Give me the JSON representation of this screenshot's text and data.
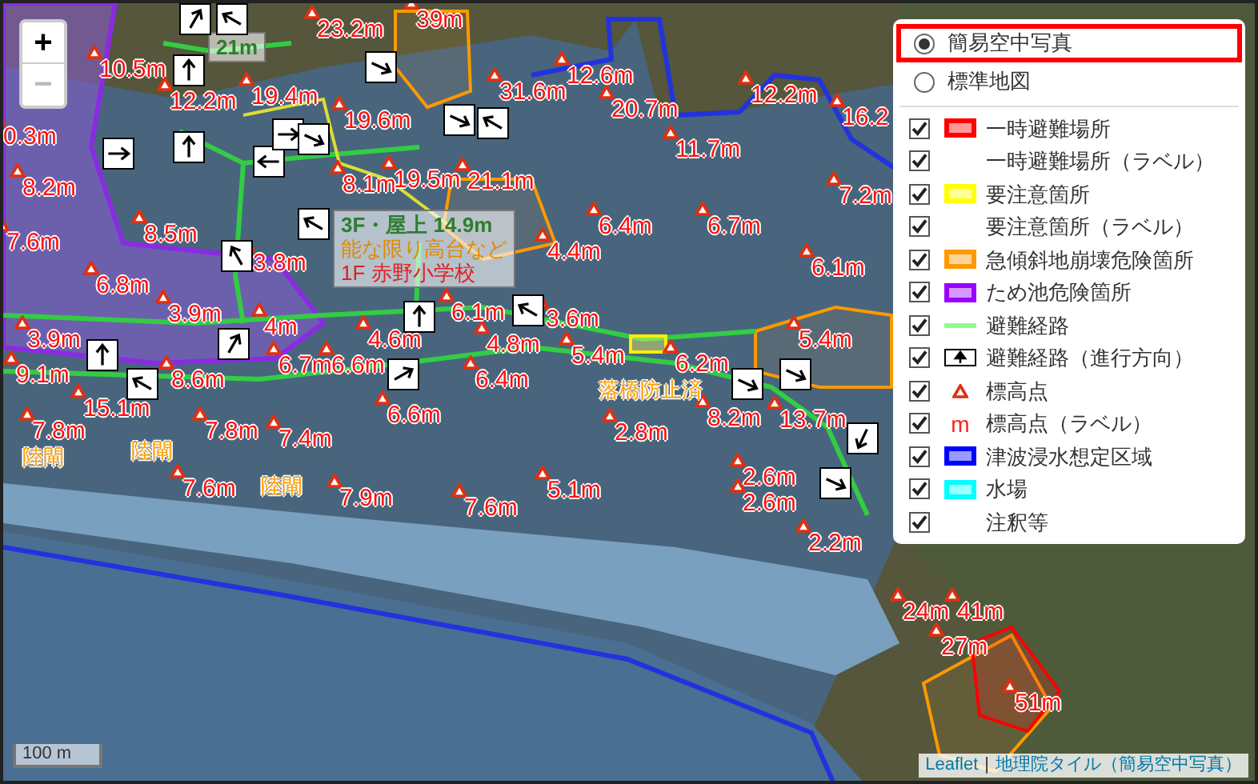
{
  "zoom_control": {
    "zoom_in": "+",
    "zoom_out": "−",
    "zoom_out_disabled": true
  },
  "layer_control": {
    "base_layers": [
      {
        "label": "簡易空中写真",
        "selected": true
      },
      {
        "label": "標準地図",
        "selected": false
      }
    ],
    "overlays": [
      {
        "label": "一時避難場所",
        "checked": true,
        "kind": "area",
        "color": "#ff0000"
      },
      {
        "label": "一時避難場所（ラベル）",
        "checked": true,
        "kind": "none"
      },
      {
        "label": "要注意箇所",
        "checked": true,
        "kind": "area",
        "color": "#ffff00"
      },
      {
        "label": "要注意箇所（ラベル）",
        "checked": true,
        "kind": "none"
      },
      {
        "label": "急傾斜地崩壊危険箇所",
        "checked": true,
        "kind": "area",
        "color": "#ff9900"
      },
      {
        "label": "ため池危険箇所",
        "checked": true,
        "kind": "area",
        "color": "#9900ff"
      },
      {
        "label": "避難経路",
        "checked": true,
        "kind": "line",
        "color": "#88ff88"
      },
      {
        "label": "避難経路（進行方向）",
        "checked": true,
        "kind": "arrow"
      },
      {
        "label": "標高点",
        "checked": true,
        "kind": "triangle"
      },
      {
        "label": "標高点（ラベル）",
        "checked": true,
        "kind": "symbol",
        "symbol": "m"
      },
      {
        "label": "津波浸水想定区域",
        "checked": true,
        "kind": "area",
        "color": "#0000ff"
      },
      {
        "label": "水場",
        "checked": true,
        "kind": "area",
        "color": "#00ffff"
      },
      {
        "label": "注釈等",
        "checked": true,
        "kind": "none"
      }
    ]
  },
  "elevation_labels": [
    "0.3m",
    "10.5m",
    "12.2m",
    "19.4m",
    "23.2m",
    "39m",
    "19.6m",
    "8.2m",
    "8.1m",
    "19.5m",
    "7.6m",
    "8.5m",
    "3.8m",
    "6.8m",
    "3.9m",
    "4m",
    "3.9m",
    "4.6m",
    "9.1m",
    "8.6m",
    "6.7m",
    "6.6m",
    "15.1m",
    "7.8m",
    "7.8m",
    "7.4m",
    "6.6m",
    "7.6m",
    "7.9m",
    "7.6m",
    "5.1m",
    "2.8m",
    "2.6m",
    "2.6m",
    "2.2m",
    "8.2m",
    "13.7m",
    "6.2m",
    "4.8m",
    "6.4m",
    "5.4m",
    "6.1m",
    "3.6m",
    "6.1m",
    "4.4m",
    "6.4m",
    "6.7m",
    "7.2m",
    "5.4m",
    "11.7m",
    "20.7m",
    "12.6m",
    "31.6m",
    "21.1m",
    "12.2m",
    "16.2",
    "24m",
    "41m",
    "27m",
    "51m"
  ],
  "annotations": [
    "陸閘",
    "陸閘",
    "陸閘",
    "落橋防止済"
  ],
  "shelter_labels": [
    {
      "lines": [
        {
          "text": "21m",
          "kind": "height"
        }
      ]
    },
    {
      "lines": [
        {
          "text": "3F・屋上 14.9m",
          "kind": "height"
        },
        {
          "text": "能な限り高台など",
          "kind": "note"
        },
        {
          "text": "1F 赤野小学校",
          "kind": "name"
        }
      ]
    }
  ],
  "scale": "100 m",
  "attribution": {
    "link": "Leaflet",
    "separator": "|",
    "source": "地理院タイル（簡易空中写真）"
  }
}
